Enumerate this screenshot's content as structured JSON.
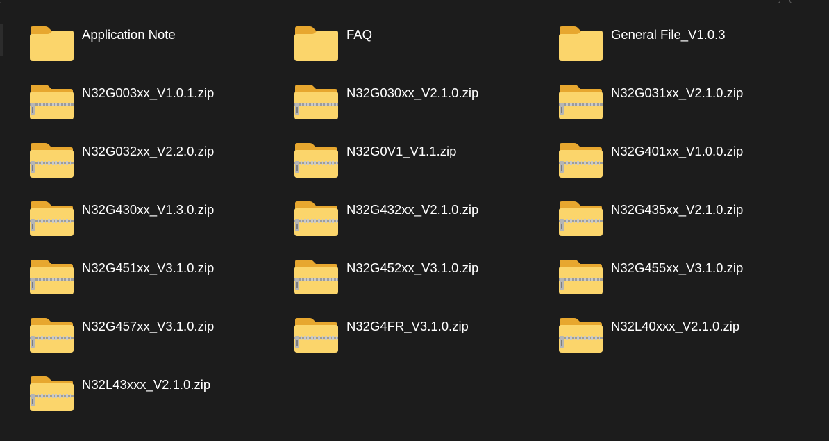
{
  "colors": {
    "background": "#1c1c1c",
    "text": "#ffffff",
    "folder_back": "#e7a72f",
    "folder_front": "#fbd56b",
    "zipper": "#9c9c9c"
  },
  "items": [
    {
      "name": "Application Note",
      "type": "folder",
      "icon": "folder-icon"
    },
    {
      "name": "FAQ",
      "type": "folder",
      "icon": "folder-icon"
    },
    {
      "name": "General File_V1.0.3",
      "type": "folder",
      "icon": "folder-icon"
    },
    {
      "name": "N32G003xx_V1.0.1.zip",
      "type": "zip",
      "icon": "zip-folder-icon"
    },
    {
      "name": "N32G030xx_V2.1.0.zip",
      "type": "zip",
      "icon": "zip-folder-icon"
    },
    {
      "name": "N32G031xx_V2.1.0.zip",
      "type": "zip",
      "icon": "zip-folder-icon"
    },
    {
      "name": "N32G032xx_V2.2.0.zip",
      "type": "zip",
      "icon": "zip-folder-icon"
    },
    {
      "name": "N32G0V1_V1.1.zip",
      "type": "zip",
      "icon": "zip-folder-icon"
    },
    {
      "name": "N32G401xx_V1.0.0.zip",
      "type": "zip",
      "icon": "zip-folder-icon"
    },
    {
      "name": "N32G430xx_V1.3.0.zip",
      "type": "zip",
      "icon": "zip-folder-icon"
    },
    {
      "name": "N32G432xx_V2.1.0.zip",
      "type": "zip",
      "icon": "zip-folder-icon"
    },
    {
      "name": "N32G435xx_V2.1.0.zip",
      "type": "zip",
      "icon": "zip-folder-icon"
    },
    {
      "name": "N32G451xx_V3.1.0.zip",
      "type": "zip",
      "icon": "zip-folder-icon"
    },
    {
      "name": "N32G452xx_V3.1.0.zip",
      "type": "zip",
      "icon": "zip-folder-icon"
    },
    {
      "name": "N32G455xx_V3.1.0.zip",
      "type": "zip",
      "icon": "zip-folder-icon"
    },
    {
      "name": "N32G457xx_V3.1.0.zip",
      "type": "zip",
      "icon": "zip-folder-icon"
    },
    {
      "name": "N32G4FR_V3.1.0.zip",
      "type": "zip",
      "icon": "zip-folder-icon"
    },
    {
      "name": "N32L40xxx_V2.1.0.zip",
      "type": "zip",
      "icon": "zip-folder-icon"
    },
    {
      "name": "N32L43xxx_V2.1.0.zip",
      "type": "zip",
      "icon": "zip-folder-icon"
    }
  ]
}
